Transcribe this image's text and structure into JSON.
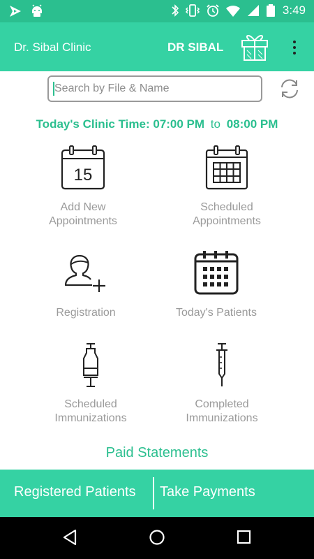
{
  "status_bar": {
    "time": "3:49",
    "icons": [
      "notification-flag-icon",
      "android-icon",
      "bluetooth-icon",
      "vibrate-icon",
      "alarm-icon",
      "wifi-icon",
      "signal-icon",
      "battery-icon"
    ]
  },
  "app_bar": {
    "title": "Dr. Sibal Clinic",
    "doctor": "DR SIBAL",
    "gift_icon": "gift-icon",
    "menu_icon": "overflow-menu-icon"
  },
  "search": {
    "placeholder": "Search by File & Name",
    "value": ""
  },
  "clinic_time": {
    "label": "Today's Clinic Time:",
    "start": "07:00 PM",
    "separator": "to",
    "end": "08:00 PM"
  },
  "tiles": [
    {
      "line1": "Add New",
      "line2": "Appointments",
      "icon": "calendar-15-icon"
    },
    {
      "line1": "Scheduled",
      "line2": "Appointments",
      "icon": "calendar-grid-icon"
    },
    {
      "line1": "Registration",
      "line2": "",
      "icon": "add-user-icon"
    },
    {
      "line1": "Today's Patients",
      "line2": "",
      "icon": "calendar-dots-icon"
    },
    {
      "line1": "Scheduled",
      "line2": "Immunizations",
      "icon": "syringe-icon"
    },
    {
      "line1": "Completed",
      "line2": "Immunizations",
      "icon": "syringe-filled-icon"
    }
  ],
  "paid_statements": "Paid Statements",
  "bottom_bar": {
    "left": "Registered Patients",
    "right": "Take Payments"
  },
  "nav": {
    "back": "back-icon",
    "home": "home-icon",
    "recents": "recents-icon"
  },
  "colors": {
    "status_bar": "#2bbf8f",
    "accent": "#35d2a3",
    "accent_text": "#2bbf8f",
    "label_grey": "#9a9a9a"
  }
}
